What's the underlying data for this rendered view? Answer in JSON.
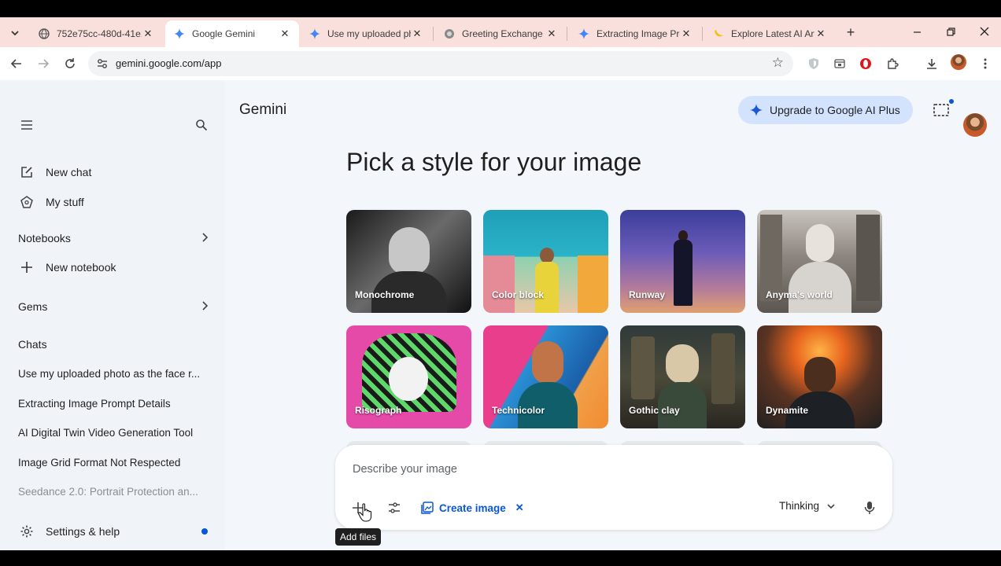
{
  "browser": {
    "tabs": [
      {
        "title": "752e75cc-480d-41e1",
        "favicon": "globe-icon",
        "active": false
      },
      {
        "title": "Google Gemini",
        "favicon": "gemini-sparkle-icon",
        "active": true
      },
      {
        "title": "Use my uploaded ph",
        "favicon": "gemini-sparkle-icon",
        "active": false
      },
      {
        "title": "Greeting Exchange",
        "favicon": "chat-bubble-icon",
        "active": false
      },
      {
        "title": "Extracting Image Pro",
        "favicon": "gemini-sparkle-icon",
        "active": false
      },
      {
        "title": "Explore Latest AI Art",
        "favicon": "banana-icon",
        "active": false
      }
    ],
    "url": "gemini.google.com/app"
  },
  "sidebar": {
    "new_chat": "New chat",
    "my_stuff": "My stuff",
    "notebooks": "Notebooks",
    "new_notebook": "New notebook",
    "gems": "Gems",
    "chats_heading": "Chats",
    "chats": [
      "Use my uploaded photo as the face r...",
      "Extracting Image Prompt Details",
      "AI Digital Twin Video Generation Tool",
      "Image Grid Format Not Respected",
      "Seedance 2.0: Portrait Protection an..."
    ],
    "settings": "Settings & help"
  },
  "header": {
    "app_name": "Gemini",
    "upgrade_label": "Upgrade to Google AI Plus"
  },
  "main": {
    "heading": "Pick a style for your image",
    "styles": [
      "Monochrome",
      "Color block",
      "Runway",
      "Anyma's world",
      "Risograph",
      "Technicolor",
      "Gothic clay",
      "Dynamite"
    ]
  },
  "composer": {
    "placeholder": "Describe your image",
    "create_image": "Create image",
    "mode": "Thinking",
    "tooltip": "Add files"
  },
  "colors": {
    "accent": "#0b57d0",
    "upgrade_bg": "#d3e3fd",
    "tab_strip": "#f9e0dc",
    "sidebar_bg": "#f0f4f9"
  }
}
